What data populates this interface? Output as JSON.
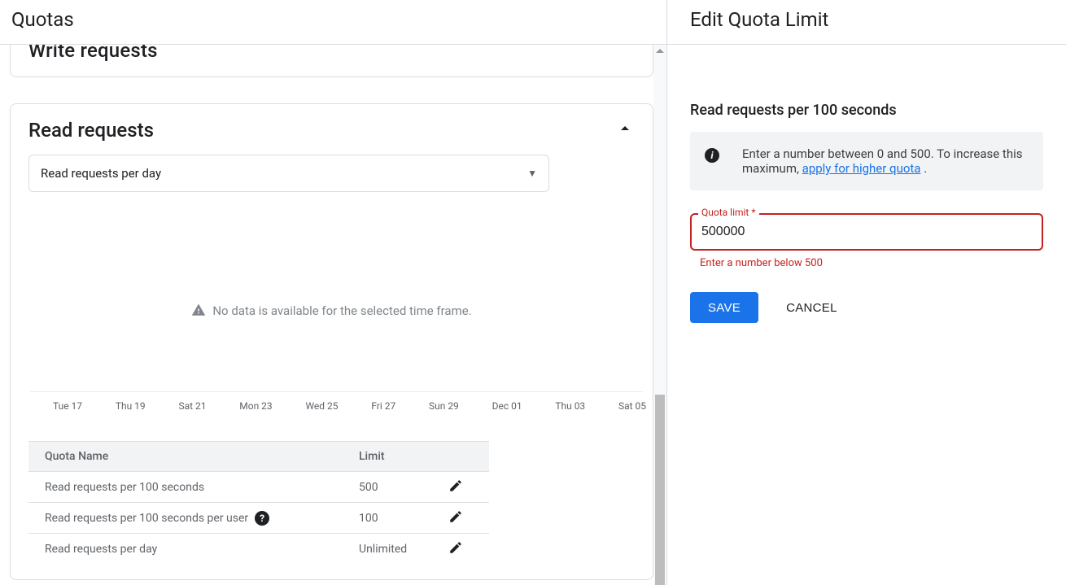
{
  "main": {
    "title": "Quotas",
    "prev_card_title": "Write requests",
    "card": {
      "title": "Read requests",
      "select_label": "Read requests per day",
      "chart_empty": "No data is available for the selected time frame.",
      "ticks": [
        "Tue 17",
        "Thu 19",
        "Sat 21",
        "Mon 23",
        "Wed 25",
        "Fri 27",
        "Sun 29",
        "Dec 01",
        "Thu 03",
        "Sat 05"
      ],
      "table": {
        "head_name": "Quota Name",
        "head_limit": "Limit",
        "rows": [
          {
            "name": "Read requests per 100 seconds",
            "limit": "500",
            "help": false,
            "editable": true
          },
          {
            "name": "Read requests per 100 seconds per user",
            "limit": "100",
            "help": true,
            "editable": true
          },
          {
            "name": "Read requests per day",
            "limit": "Unlimited",
            "help": false,
            "editable": true
          }
        ]
      }
    }
  },
  "side": {
    "title": "Edit Quota Limit",
    "subtitle": "Read requests per 100 seconds",
    "info_text_a": "Enter a number between 0 and 500. To increase this maximum, ",
    "info_link": "apply for higher quota",
    "info_text_b": " .",
    "field_label": "Quota limit *",
    "field_value": "500000",
    "field_error": "Enter a number below 500",
    "save": "SAVE",
    "cancel": "CANCEL"
  },
  "chart_data": {
    "type": "line",
    "title": "Read requests per day",
    "x": [
      "Tue 17",
      "Thu 19",
      "Sat 21",
      "Mon 23",
      "Wed 25",
      "Fri 27",
      "Sun 29",
      "Dec 01",
      "Thu 03",
      "Sat 05"
    ],
    "series": [],
    "note": "No data is available for the selected time frame."
  }
}
